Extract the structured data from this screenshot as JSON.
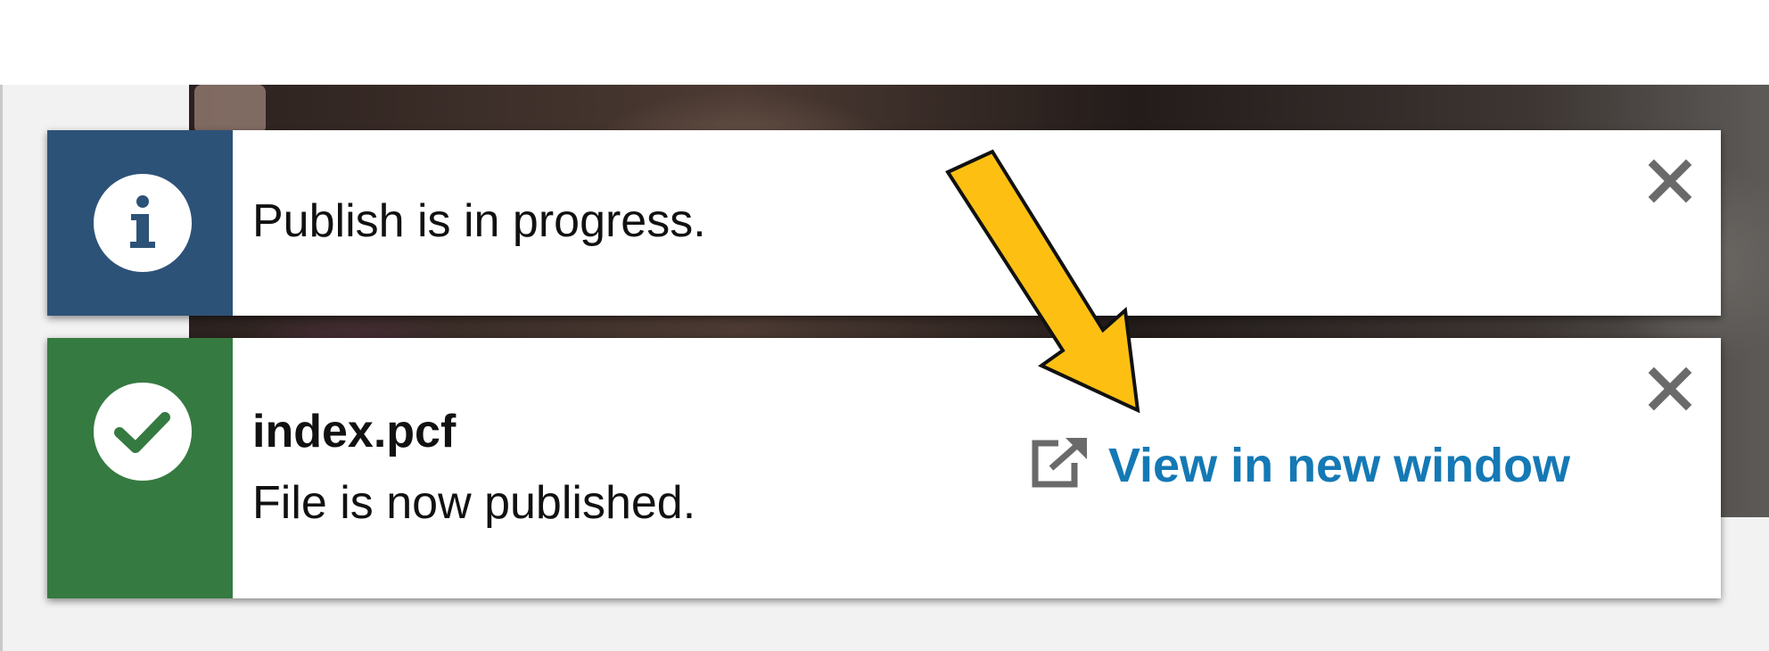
{
  "notifications": [
    {
      "type": "info",
      "icon": "info-icon",
      "accent_color": "#2d5278",
      "message": "Publish is in progress.",
      "close_icon": "close-icon"
    },
    {
      "type": "success",
      "icon": "checkmark-icon",
      "accent_color": "#357a41",
      "title": "index.pcf",
      "message": "File is now published.",
      "action": {
        "label": "View in new window",
        "icon": "external-link-icon",
        "color": "#1479b5"
      },
      "close_icon": "close-icon"
    }
  ],
  "annotation": {
    "type": "arrow",
    "color": "#fdc012",
    "points_to": "View in new window"
  }
}
